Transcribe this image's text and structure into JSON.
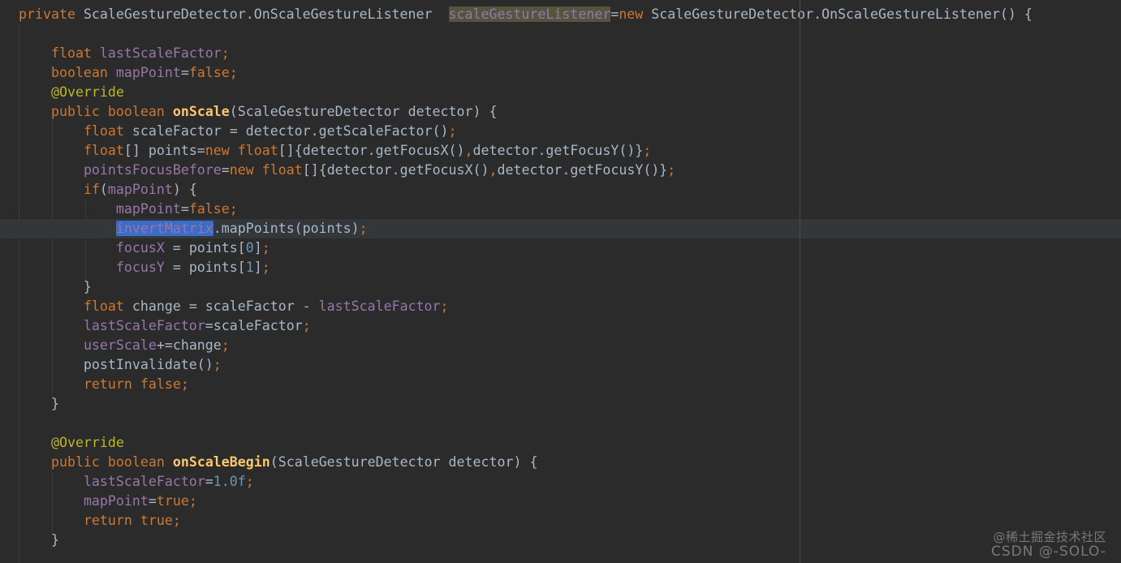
{
  "window": {
    "description": "Dark-theme Java code editor showing a ScaleGestureDetector.OnScaleGestureListener anonymous class"
  },
  "colors": {
    "background": "#2b2b2b",
    "current_line": "#34373a",
    "keyword": "#cc7832",
    "text": "#a9b7c6",
    "field": "#9876aa",
    "annotation": "#bbb529",
    "method": "#ffc66d",
    "number": "#6897bb",
    "punct": "#cc7832",
    "selection_blue": "#3b6cc7",
    "highlight_olive": "#54553c",
    "margin_guide": "#4a4c4e",
    "indent_guide": "#3a3c3e",
    "watermark": "#a8a8a8"
  },
  "watermark": {
    "line1": "@稀土掘金技术社区",
    "line2": "CSDN @-SOLO-"
  },
  "editor": {
    "lines": [
      {
        "segments": [
          {
            "c": "kw",
            "t": "private"
          },
          {
            "c": "tx",
            "t": " ScaleGestureDetector.OnScaleGestureListener  "
          },
          {
            "c": "fld",
            "t": "scaleGestureListener",
            "m": "hl-olive"
          },
          {
            "c": "tx",
            "t": "="
          },
          {
            "c": "kw",
            "t": "new"
          },
          {
            "c": "tx",
            "t": " ScaleGestureDetector.OnScaleGestureListener() {"
          }
        ]
      },
      {
        "segments": []
      },
      {
        "segments": [
          {
            "c": "tx",
            "t": "    "
          },
          {
            "c": "kw",
            "t": "float"
          },
          {
            "c": "tx",
            "t": " "
          },
          {
            "c": "fld",
            "t": "lastScaleFactor"
          },
          {
            "c": "sep",
            "t": ";"
          }
        ]
      },
      {
        "segments": [
          {
            "c": "tx",
            "t": "    "
          },
          {
            "c": "kw",
            "t": "boolean"
          },
          {
            "c": "tx",
            "t": " "
          },
          {
            "c": "fld",
            "t": "mapPoint"
          },
          {
            "c": "tx",
            "t": "="
          },
          {
            "c": "kw",
            "t": "false"
          },
          {
            "c": "sep",
            "t": ";"
          }
        ]
      },
      {
        "segments": [
          {
            "c": "tx",
            "t": "    "
          },
          {
            "c": "ann",
            "t": "@Override"
          }
        ]
      },
      {
        "segments": [
          {
            "c": "tx",
            "t": "    "
          },
          {
            "c": "kw",
            "t": "public"
          },
          {
            "c": "tx",
            "t": " "
          },
          {
            "c": "kw",
            "t": "boolean"
          },
          {
            "c": "tx",
            "t": " "
          },
          {
            "c": "mth",
            "t": "onScale"
          },
          {
            "c": "tx",
            "t": "(ScaleGestureDetector detector) {"
          }
        ]
      },
      {
        "segments": [
          {
            "c": "tx",
            "t": "        "
          },
          {
            "c": "kw",
            "t": "float"
          },
          {
            "c": "tx",
            "t": " scaleFactor = detector.getScaleFactor()"
          },
          {
            "c": "sep",
            "t": ";"
          }
        ]
      },
      {
        "segments": [
          {
            "c": "tx",
            "t": "        "
          },
          {
            "c": "kw",
            "t": "float"
          },
          {
            "c": "tx",
            "t": "[] points="
          },
          {
            "c": "kw",
            "t": "new"
          },
          {
            "c": "tx",
            "t": " "
          },
          {
            "c": "kw",
            "t": "float"
          },
          {
            "c": "tx",
            "t": "[]{detector.getFocusX()"
          },
          {
            "c": "sep",
            "t": ","
          },
          {
            "c": "tx",
            "t": "detector.getFocusY()}"
          },
          {
            "c": "sep",
            "t": ";"
          }
        ]
      },
      {
        "segments": [
          {
            "c": "tx",
            "t": "        "
          },
          {
            "c": "fld",
            "t": "pointsFocusBefore"
          },
          {
            "c": "tx",
            "t": "="
          },
          {
            "c": "kw",
            "t": "new"
          },
          {
            "c": "tx",
            "t": " "
          },
          {
            "c": "kw",
            "t": "float"
          },
          {
            "c": "tx",
            "t": "[]{detector.getFocusX()"
          },
          {
            "c": "sep",
            "t": ","
          },
          {
            "c": "tx",
            "t": "detector.getFocusY()}"
          },
          {
            "c": "sep",
            "t": ";"
          }
        ]
      },
      {
        "segments": [
          {
            "c": "tx",
            "t": "        "
          },
          {
            "c": "kw",
            "t": "if"
          },
          {
            "c": "tx",
            "t": "("
          },
          {
            "c": "fld",
            "t": "mapPoint"
          },
          {
            "c": "tx",
            "t": ") {"
          }
        ]
      },
      {
        "segments": [
          {
            "c": "tx",
            "t": "            "
          },
          {
            "c": "fld",
            "t": "mapPoint"
          },
          {
            "c": "tx",
            "t": "="
          },
          {
            "c": "kw",
            "t": "false"
          },
          {
            "c": "sep",
            "t": ";"
          }
        ]
      },
      {
        "current": true,
        "segments": [
          {
            "c": "tx",
            "t": "            "
          },
          {
            "c": "fld",
            "t": "invertMatrix",
            "m": "hl-blue"
          },
          {
            "c": "tx",
            "t": ".mapPoints(points)"
          },
          {
            "c": "sep",
            "t": ";"
          }
        ]
      },
      {
        "segments": [
          {
            "c": "tx",
            "t": "            "
          },
          {
            "c": "fld",
            "t": "focusX"
          },
          {
            "c": "tx",
            "t": " = points["
          },
          {
            "c": "num",
            "t": "0"
          },
          {
            "c": "tx",
            "t": "]"
          },
          {
            "c": "sep",
            "t": ";"
          }
        ]
      },
      {
        "segments": [
          {
            "c": "tx",
            "t": "            "
          },
          {
            "c": "fld",
            "t": "focusY"
          },
          {
            "c": "tx",
            "t": " = points["
          },
          {
            "c": "num",
            "t": "1"
          },
          {
            "c": "tx",
            "t": "]"
          },
          {
            "c": "sep",
            "t": ";"
          }
        ]
      },
      {
        "segments": [
          {
            "c": "tx",
            "t": "        }"
          }
        ]
      },
      {
        "segments": [
          {
            "c": "tx",
            "t": "        "
          },
          {
            "c": "kw",
            "t": "float"
          },
          {
            "c": "tx",
            "t": " change = scaleFactor - "
          },
          {
            "c": "fld",
            "t": "lastScaleFactor"
          },
          {
            "c": "sep",
            "t": ";"
          }
        ]
      },
      {
        "segments": [
          {
            "c": "tx",
            "t": "        "
          },
          {
            "c": "fld",
            "t": "lastScaleFactor"
          },
          {
            "c": "tx",
            "t": "=scaleFactor"
          },
          {
            "c": "sep",
            "t": ";"
          }
        ]
      },
      {
        "segments": [
          {
            "c": "tx",
            "t": "        "
          },
          {
            "c": "fld",
            "t": "userScale"
          },
          {
            "c": "tx",
            "t": "+=change"
          },
          {
            "c": "sep",
            "t": ";"
          }
        ]
      },
      {
        "segments": [
          {
            "c": "tx",
            "t": "        postInvalidate()"
          },
          {
            "c": "sep",
            "t": ";"
          }
        ]
      },
      {
        "segments": [
          {
            "c": "tx",
            "t": "        "
          },
          {
            "c": "kw",
            "t": "return"
          },
          {
            "c": "tx",
            "t": " "
          },
          {
            "c": "kw",
            "t": "false"
          },
          {
            "c": "sep",
            "t": ";"
          }
        ]
      },
      {
        "segments": [
          {
            "c": "tx",
            "t": "    }"
          }
        ]
      },
      {
        "segments": []
      },
      {
        "segments": [
          {
            "c": "tx",
            "t": "    "
          },
          {
            "c": "ann",
            "t": "@Override"
          }
        ]
      },
      {
        "segments": [
          {
            "c": "tx",
            "t": "    "
          },
          {
            "c": "kw",
            "t": "public"
          },
          {
            "c": "tx",
            "t": " "
          },
          {
            "c": "kw",
            "t": "boolean"
          },
          {
            "c": "tx",
            "t": " "
          },
          {
            "c": "mth",
            "t": "onScaleBegin"
          },
          {
            "c": "tx",
            "t": "(ScaleGestureDetector detector) {"
          }
        ]
      },
      {
        "segments": [
          {
            "c": "tx",
            "t": "        "
          },
          {
            "c": "fld",
            "t": "lastScaleFactor"
          },
          {
            "c": "tx",
            "t": "="
          },
          {
            "c": "num",
            "t": "1.0f"
          },
          {
            "c": "sep",
            "t": ";"
          }
        ]
      },
      {
        "segments": [
          {
            "c": "tx",
            "t": "        "
          },
          {
            "c": "fld",
            "t": "mapPoint"
          },
          {
            "c": "tx",
            "t": "="
          },
          {
            "c": "kw",
            "t": "true"
          },
          {
            "c": "sep",
            "t": ";"
          }
        ]
      },
      {
        "segments": [
          {
            "c": "tx",
            "t": "        "
          },
          {
            "c": "kw",
            "t": "return"
          },
          {
            "c": "tx",
            "t": " "
          },
          {
            "c": "kw",
            "t": "true"
          },
          {
            "c": "sep",
            "t": ";"
          }
        ]
      },
      {
        "segments": [
          {
            "c": "tx",
            "t": "    }"
          }
        ]
      }
    ]
  }
}
